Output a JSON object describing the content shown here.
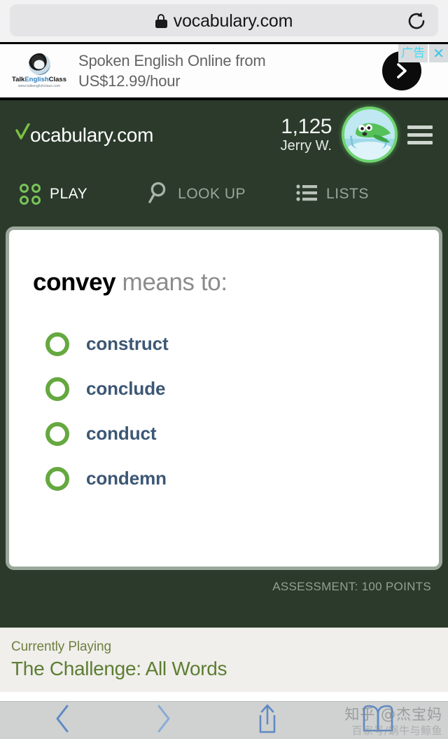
{
  "browser": {
    "url": "vocabulary.com",
    "lock_icon": "lock-icon",
    "reload_icon": "reload-icon",
    "toolbar": {
      "back_icon": "chevron-left-icon",
      "forward_icon": "chevron-right-icon",
      "share_icon": "share-upload-icon",
      "bookmarks_icon": "open-book-icon"
    }
  },
  "ad": {
    "advertiser": "TalkEnglishClass",
    "advertiser_prefix": "Talk",
    "advertiser_mid": "English",
    "advertiser_suffix": "Class",
    "advertiser_url": "www.talkenglishclass.com",
    "headline": "Spoken English Online from US$12.99/hour",
    "tag_label": "广告",
    "close_label": "✕",
    "cta_icon": "chevron-right-circle-icon",
    "logo_icon": "headphones-globe-icon"
  },
  "header": {
    "brand": "ocabulary.com",
    "brand_check": "check-v-icon",
    "score": "1,125",
    "username": "Jerry W.",
    "avatar_icon": "fish-avatar-icon",
    "menu_icon": "hamburger-menu-icon"
  },
  "nav": [
    {
      "label": "PLAY",
      "icon": "four-circles-icon",
      "active": true
    },
    {
      "label": "LOOK UP",
      "icon": "magnifier-icon",
      "active": false
    },
    {
      "label": "LISTS",
      "icon": "list-lines-icon",
      "active": false
    }
  ],
  "question": {
    "word": "convey",
    "prompt": " means to:",
    "options": [
      {
        "label": "construct"
      },
      {
        "label": "conclude"
      },
      {
        "label": "conduct"
      },
      {
        "label": "condemn"
      }
    ],
    "assessment": "ASSESSMENT: 100 POINTS"
  },
  "playing": {
    "eyebrow": "Currently Playing",
    "title": "The Challenge: All Words"
  },
  "watermark": {
    "main": "知乎 @杰宝妈",
    "sub": "百家号/蜗牛与鲸鱼"
  },
  "colors": {
    "site_bg": "#2b3a2b",
    "accent_green": "#79c35a",
    "option_text": "#3c5775",
    "playing_green": "#5d7d33",
    "ad_tag_cyan": "#33c9e8"
  }
}
